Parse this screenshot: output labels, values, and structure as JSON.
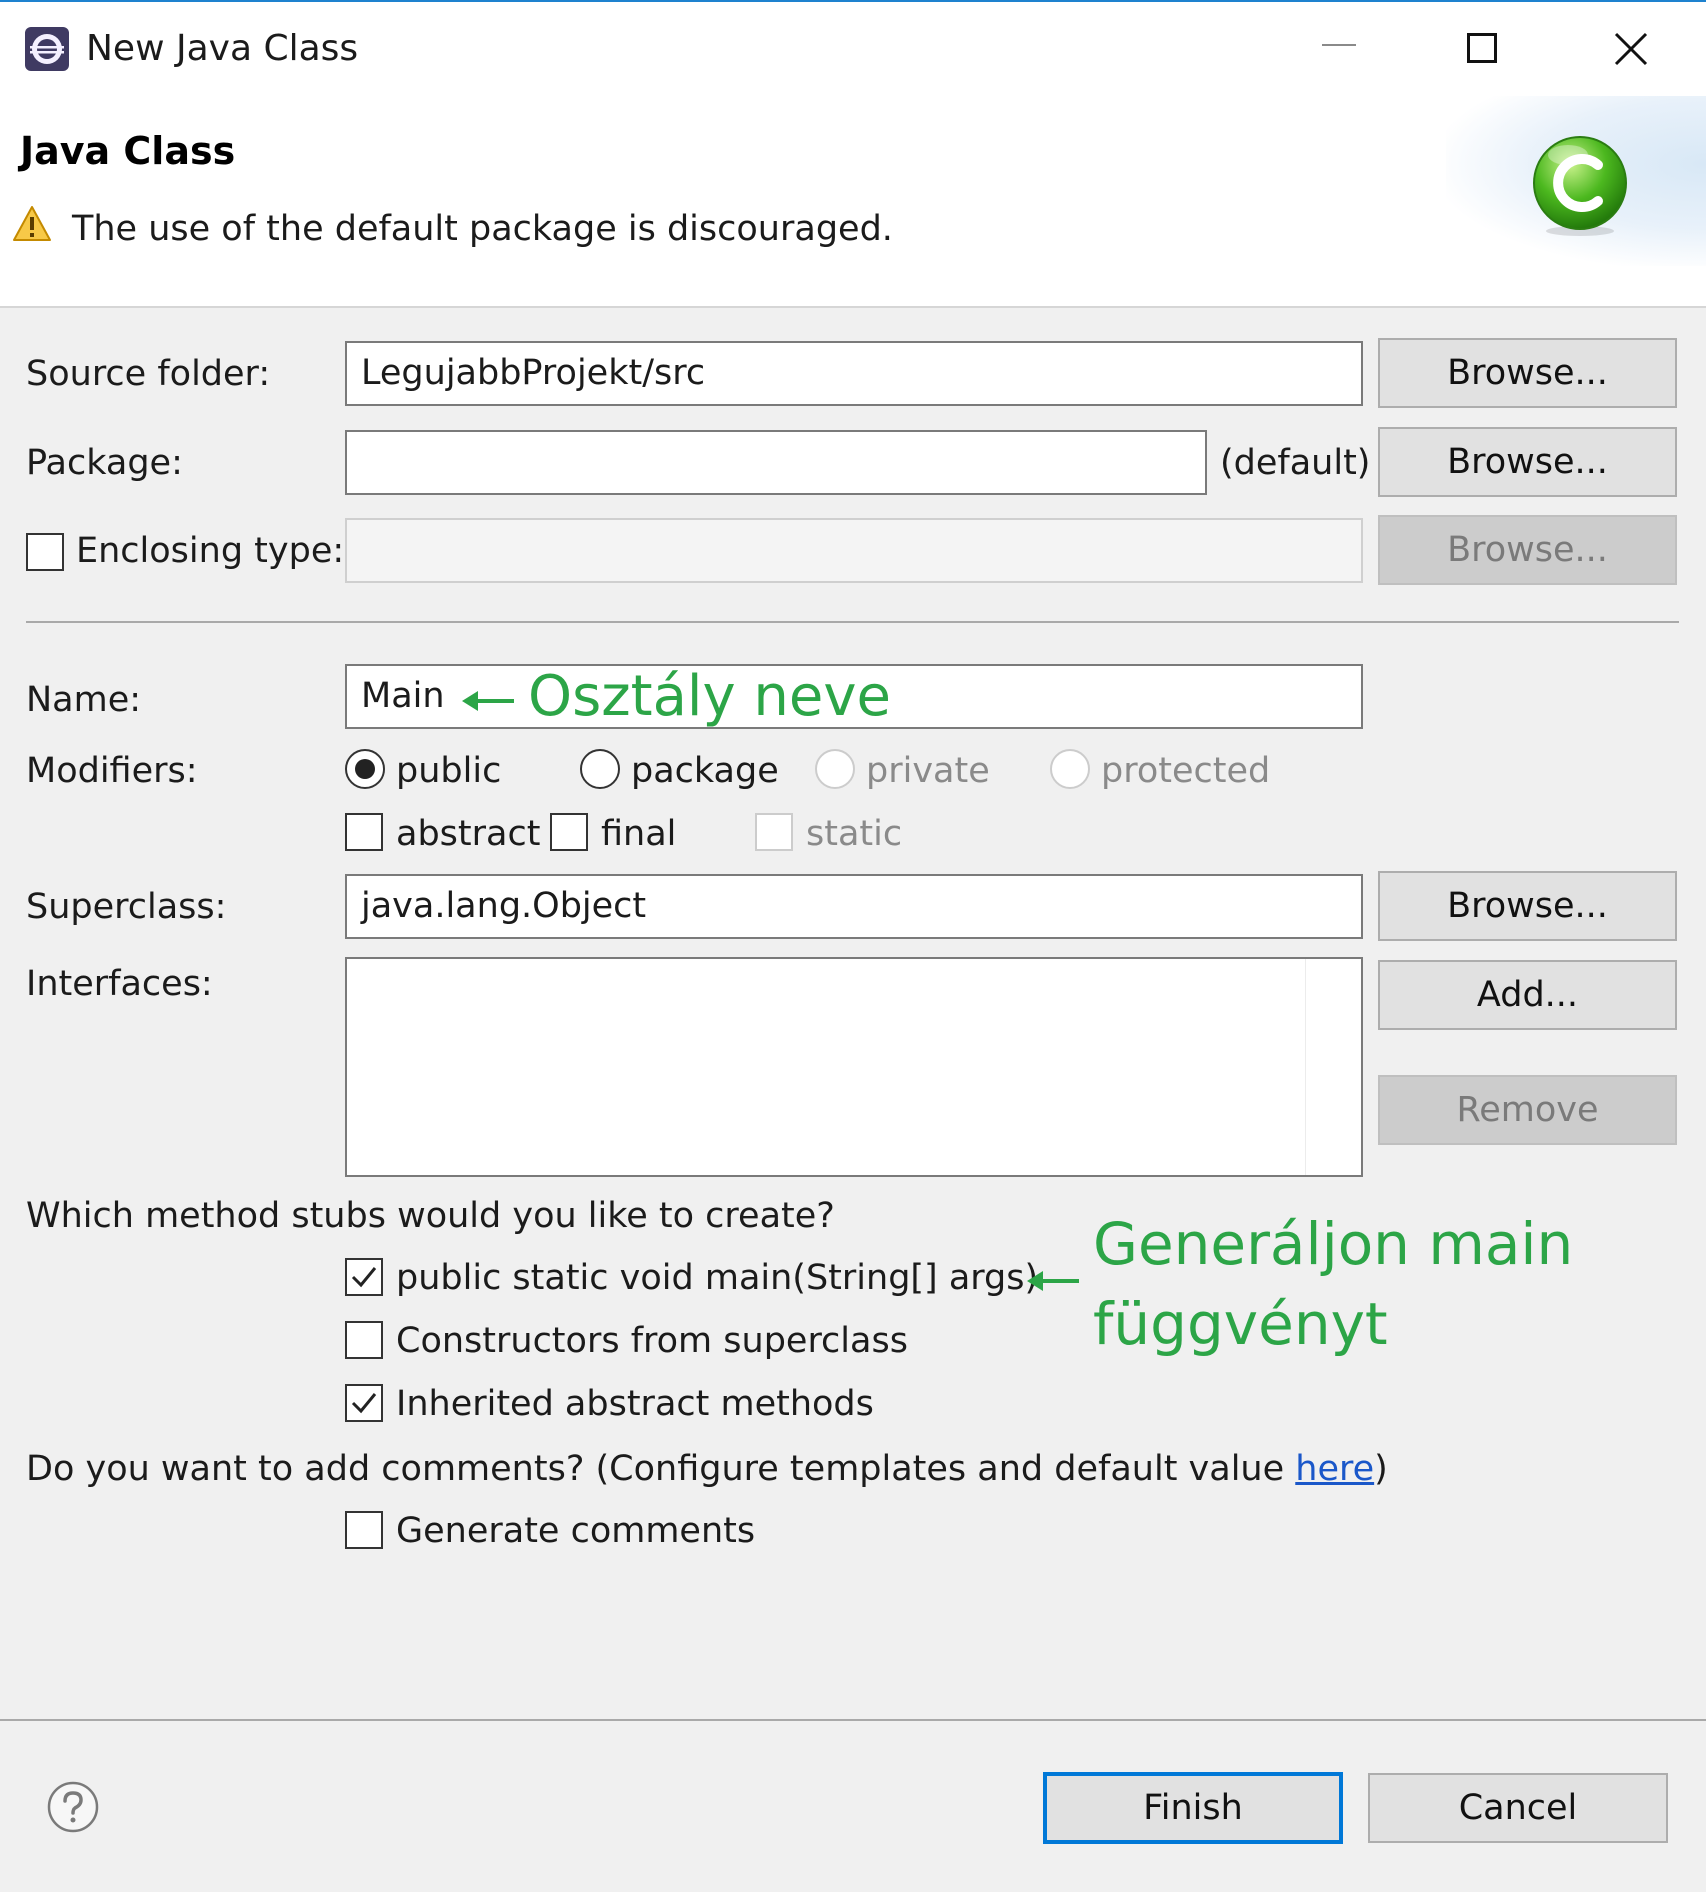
{
  "window": {
    "title": "New Java Class"
  },
  "header": {
    "title": "Java Class",
    "message": "The use of the default package is discouraged."
  },
  "form": {
    "source_folder": {
      "label": "Source folder:",
      "value": "LegujabbProjekt/src",
      "browse": "Browse..."
    },
    "package": {
      "label": "Package:",
      "value": "",
      "default_note": "(default)",
      "browse": "Browse..."
    },
    "enclosing_type": {
      "label": "Enclosing type:",
      "checked": false,
      "value": "",
      "browse": "Browse..."
    },
    "name": {
      "label": "Name:",
      "value": "Main"
    },
    "modifiers": {
      "label": "Modifiers:",
      "options": [
        {
          "label": "public",
          "selected": true,
          "enabled": true
        },
        {
          "label": "package",
          "selected": false,
          "enabled": true
        },
        {
          "label": "private",
          "selected": false,
          "enabled": false
        },
        {
          "label": "protected",
          "selected": false,
          "enabled": false
        }
      ],
      "flags": [
        {
          "label": "abstract",
          "checked": false,
          "enabled": true
        },
        {
          "label": "final",
          "checked": false,
          "enabled": true
        },
        {
          "label": "static",
          "checked": false,
          "enabled": false
        }
      ]
    },
    "superclass": {
      "label": "Superclass:",
      "value": "java.lang.Object",
      "browse": "Browse..."
    },
    "interfaces": {
      "label": "Interfaces:",
      "items": [],
      "add": "Add...",
      "remove": "Remove"
    },
    "stubs": {
      "question": "Which method stubs would you like to create?",
      "options": [
        {
          "label": "public static void main(String[] args)",
          "checked": true
        },
        {
          "label": "Constructors from superclass",
          "checked": false
        },
        {
          "label": "Inherited abstract methods",
          "checked": true
        }
      ]
    },
    "comments": {
      "question": "Do you want to add comments? (Configure templates and default value ",
      "link": "here",
      "question_end": ")",
      "option": {
        "label": "Generate comments",
        "checked": false
      }
    }
  },
  "annotations": {
    "name_note": "Osztály neve",
    "main_note_line1": "Generáljon main",
    "main_note_line2": "függvényt",
    "color": "#2ca547"
  },
  "footer": {
    "finish": "Finish",
    "cancel": "Cancel"
  }
}
